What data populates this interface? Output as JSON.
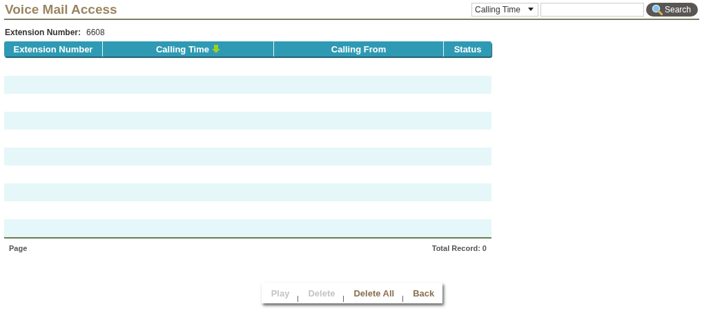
{
  "title": "Voice Mail Access",
  "search": {
    "field": "Calling Time",
    "button": "Search"
  },
  "extension": {
    "label": "Extension Number:",
    "value": "6608"
  },
  "table": {
    "columns": [
      {
        "label": "Extension Number",
        "sorted": false
      },
      {
        "label": "Calling Time",
        "sorted": true
      },
      {
        "label": "Calling From",
        "sorted": false
      },
      {
        "label": "Status",
        "sorted": false
      }
    ]
  },
  "footer": {
    "page_label": "Page",
    "total": "Total Record: 0"
  },
  "buttons": [
    {
      "label": "Play",
      "disabled": true
    },
    {
      "label": "Delete",
      "disabled": true
    },
    {
      "label": "Delete All",
      "disabled": false
    },
    {
      "label": "Back",
      "disabled": false
    }
  ]
}
